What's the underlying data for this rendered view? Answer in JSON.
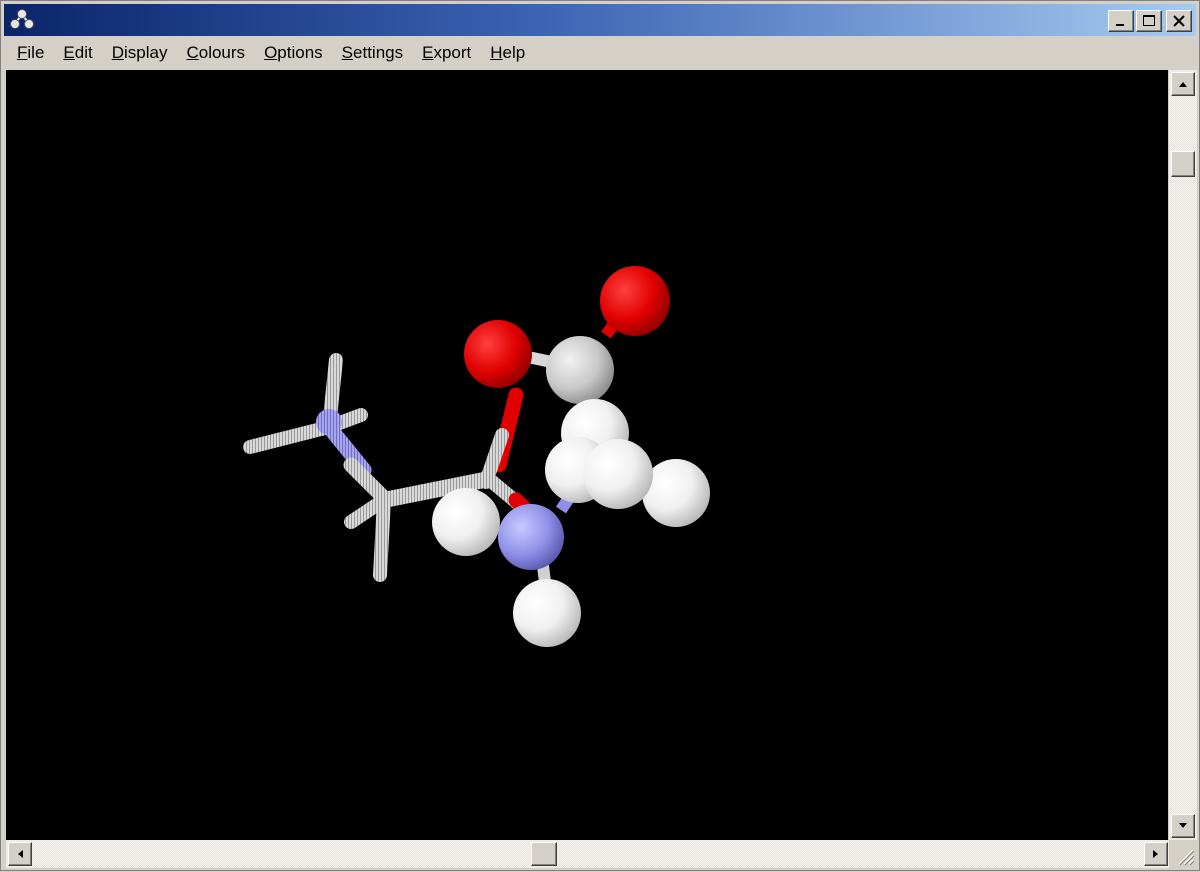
{
  "window": {
    "title": "",
    "title_gradient": [
      "#0a246a",
      "#a6caf0"
    ]
  },
  "menubar": {
    "items": [
      {
        "label": "File"
      },
      {
        "label": "Edit"
      },
      {
        "label": "Display"
      },
      {
        "label": "Colours"
      },
      {
        "label": "Options"
      },
      {
        "label": "Settings"
      },
      {
        "label": "Export"
      },
      {
        "label": "Help"
      }
    ]
  },
  "viewer": {
    "background": "#000000",
    "atom_colors": {
      "carbon": "#c8c8c8",
      "oxygen": "#e60000",
      "nitrogen": "#8f8fff",
      "hydrogen": "#ffffff"
    },
    "render_modes": [
      "sticks",
      "spacefill"
    ]
  },
  "scrollbars": {
    "vertical_position": 0.11,
    "horizontal_position": 0.47
  }
}
